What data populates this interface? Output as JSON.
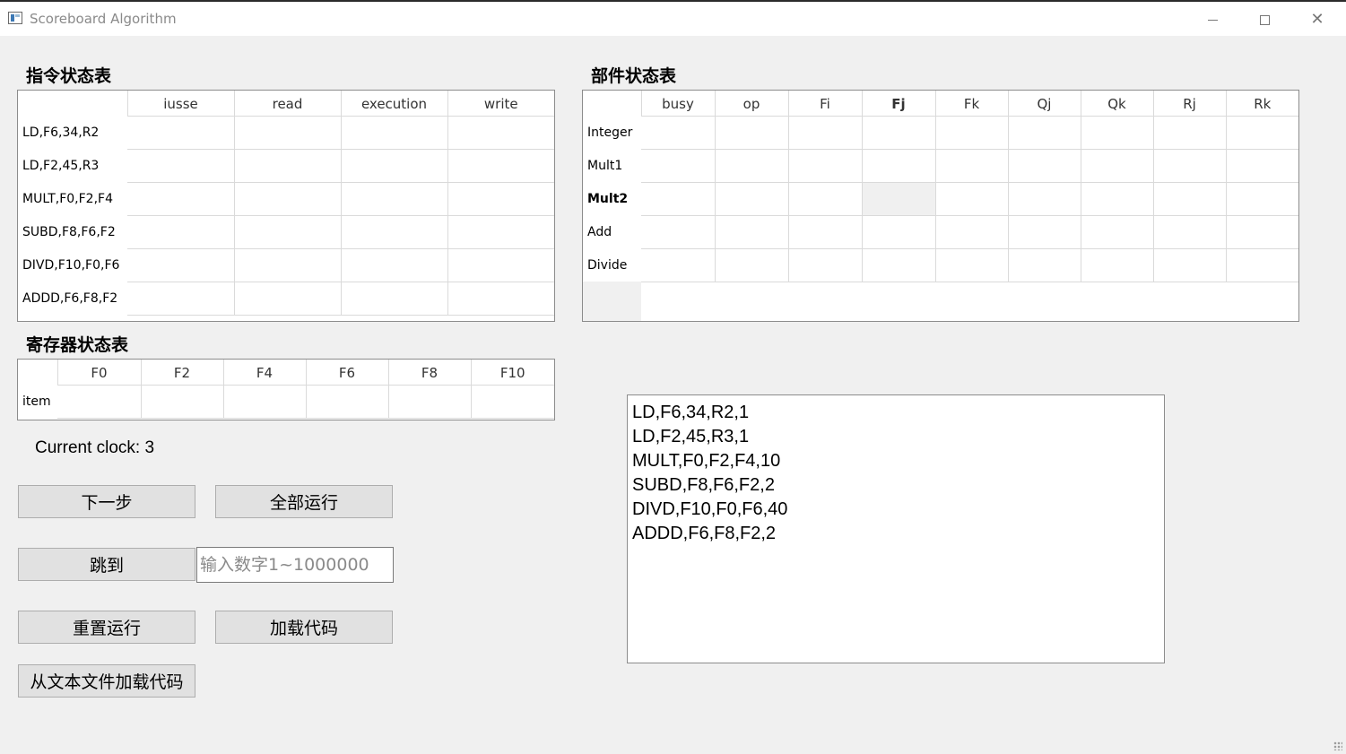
{
  "window": {
    "title": "Scoreboard Algorithm"
  },
  "instruction_status": {
    "title": "指令状态表",
    "columns": [
      "iusse",
      "read",
      "execution",
      "write"
    ],
    "rows": [
      {
        "label": "LD,F6,34,R2"
      },
      {
        "label": "LD,F2,45,R3"
      },
      {
        "label": "MULT,F0,F2,F4"
      },
      {
        "label": "SUBD,F8,F6,F2"
      },
      {
        "label": "DIVD,F10,F0,F6"
      },
      {
        "label": "ADDD,F6,F8,F2"
      }
    ]
  },
  "unit_status": {
    "title": "部件状态表",
    "columns": [
      "busy",
      "op",
      "Fi",
      "Fj",
      "Fk",
      "Qj",
      "Qk",
      "Rj",
      "Rk"
    ],
    "rows": [
      {
        "label": "Integer"
      },
      {
        "label": "Mult1"
      },
      {
        "label": "Mult2"
      },
      {
        "label": "Add"
      },
      {
        "label": "Divide"
      }
    ]
  },
  "register_status": {
    "title": "寄存器状态表",
    "columns": [
      "F0",
      "F2",
      "F4",
      "F6",
      "F8",
      "F10"
    ],
    "row_label": "item"
  },
  "clock": {
    "text": "Current clock: 3"
  },
  "buttons": {
    "next": "下一步",
    "run_all": "全部运行",
    "jump": "跳到",
    "reset": "重置运行",
    "load_code": "加载代码",
    "load_file": "从文本文件加载代码"
  },
  "jump_input": {
    "placeholder": "输入数字1~1000000",
    "value": ""
  },
  "code_editor": {
    "lines": [
      "LD,F6,34,R2,1",
      "LD,F2,45,R3,1",
      "MULT,F0,F2,F4,10",
      "SUBD,F8,F6,F2,2",
      "DIVD,F10,F0,F6,40",
      "ADDD,F6,F8,F2,2"
    ]
  }
}
